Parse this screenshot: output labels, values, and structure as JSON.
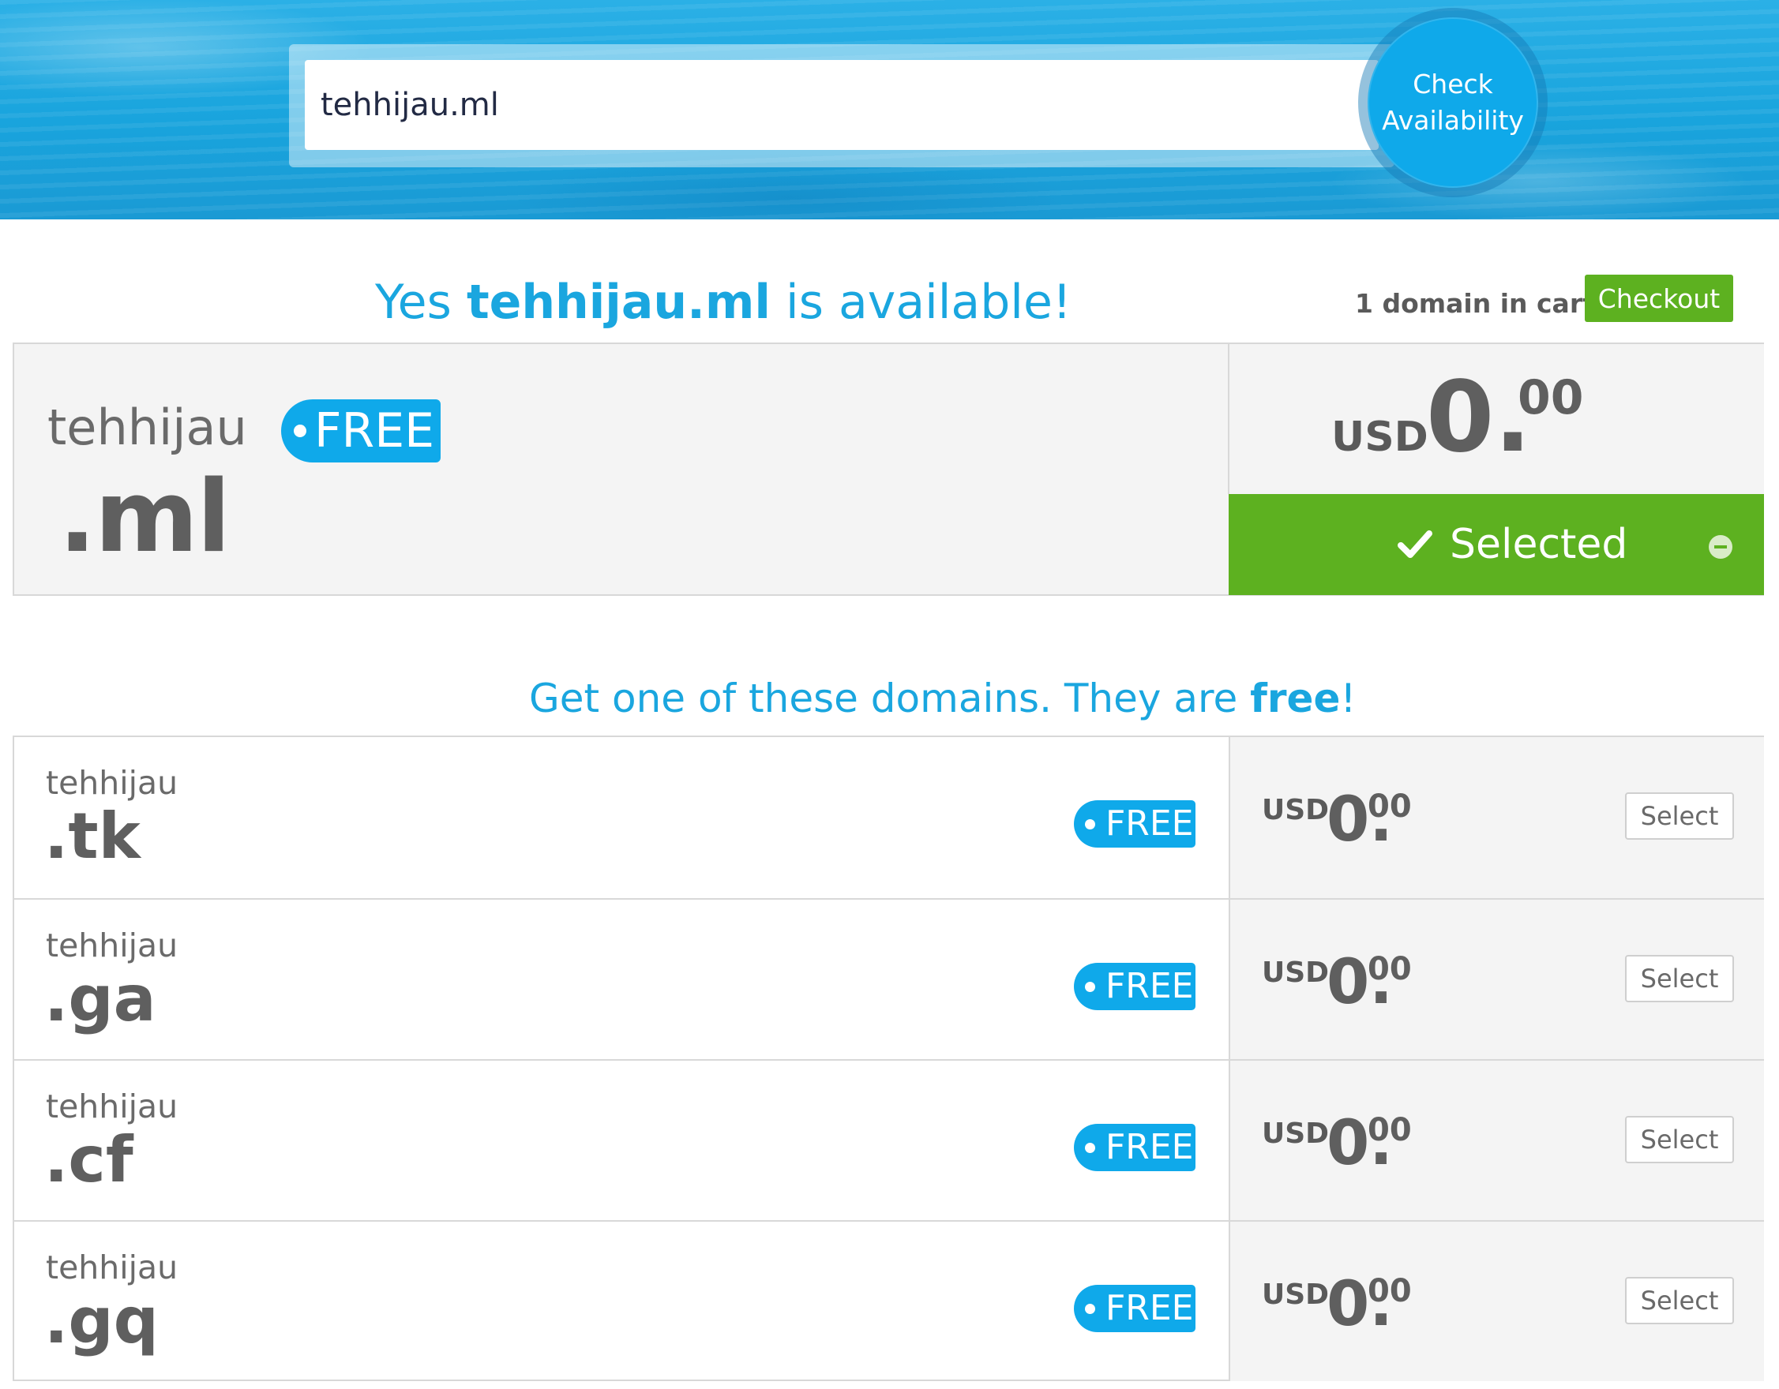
{
  "search": {
    "value": "tehhijau.ml",
    "button_line1": "Check",
    "button_line2": "Availability"
  },
  "result": {
    "headline_prefix": "Yes ",
    "headline_domain": "tehhijau.ml",
    "headline_suffix": " is available!",
    "cart_count_text": "1 domain in cart",
    "checkout_label": "Checkout"
  },
  "selected_domain": {
    "name": "tehhijau",
    "tld": ".ml",
    "badge": "FREE",
    "currency": "USD",
    "price_int": "0.",
    "price_dec": "00",
    "button_label": "Selected"
  },
  "suggestions": {
    "title_prefix": "Get one of these domains. They are ",
    "title_bold": "free",
    "title_suffix": "!",
    "items": [
      {
        "name": "tehhijau",
        "tld": ".tk",
        "badge": "FREE",
        "currency": "USD",
        "price_int": "0.",
        "price_dec": "00",
        "button": "Select"
      },
      {
        "name": "tehhijau",
        "tld": ".ga",
        "badge": "FREE",
        "currency": "USD",
        "price_int": "0.",
        "price_dec": "00",
        "button": "Select"
      },
      {
        "name": "tehhijau",
        "tld": ".cf",
        "badge": "FREE",
        "currency": "USD",
        "price_int": "0.",
        "price_dec": "00",
        "button": "Select"
      },
      {
        "name": "tehhijau",
        "tld": ".gq",
        "badge": "FREE",
        "currency": "USD",
        "price_int": "0.",
        "price_dec": "00",
        "button": "Select"
      }
    ]
  },
  "colors": {
    "brand_blue": "#1aa6df",
    "badge_blue": "#0fa9ea",
    "success_green": "#5db120",
    "text_gray": "#5f5f5f"
  },
  "icons": {
    "selected_check": "checkmark-icon",
    "remove": "minus-circle-icon",
    "badge_dot": "dot-icon"
  }
}
